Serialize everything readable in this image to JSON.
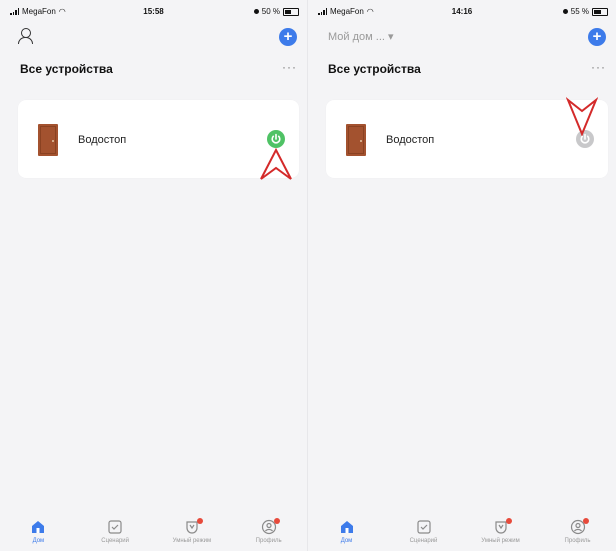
{
  "left": {
    "status": {
      "carrier": "MegaFon",
      "time": "15:58",
      "battery": "50 %",
      "battery_level": 0.5
    },
    "section_title": "Все устройства",
    "more": "···",
    "add_label": "+",
    "device": {
      "name": "Водостоп",
      "power_state": "on",
      "icon": "door-icon"
    },
    "tabs": [
      {
        "label": "Дом",
        "icon": "home-icon",
        "active": true
      },
      {
        "label": "Сценарий",
        "icon": "scenario-icon",
        "active": false
      },
      {
        "label": "Умный режим",
        "icon": "smart-mode-icon",
        "active": false
      },
      {
        "label": "Профиль",
        "icon": "profile-icon",
        "active": false
      }
    ]
  },
  "right": {
    "status": {
      "carrier": "MegaFon",
      "time": "14:16",
      "battery": "55 %",
      "battery_level": 0.55
    },
    "home_select": "Мой дом ... ▾",
    "section_title": "Все устройства",
    "more": "···",
    "add_label": "+",
    "device": {
      "name": "Водостоп",
      "power_state": "off",
      "icon": "door-icon"
    },
    "tabs": [
      {
        "label": "Дом",
        "icon": "home-icon",
        "active": true
      },
      {
        "label": "Сценарий",
        "icon": "scenario-icon",
        "active": false
      },
      {
        "label": "Умный режим",
        "icon": "smart-mode-icon",
        "active": false
      },
      {
        "label": "Профиль",
        "icon": "profile-icon",
        "active": false
      }
    ]
  },
  "colors": {
    "accent": "#3d7bea",
    "power_on": "#4fc265",
    "power_off": "#c8c8ca",
    "badge": "#e74a3b",
    "arrow": "#d42a2a"
  }
}
